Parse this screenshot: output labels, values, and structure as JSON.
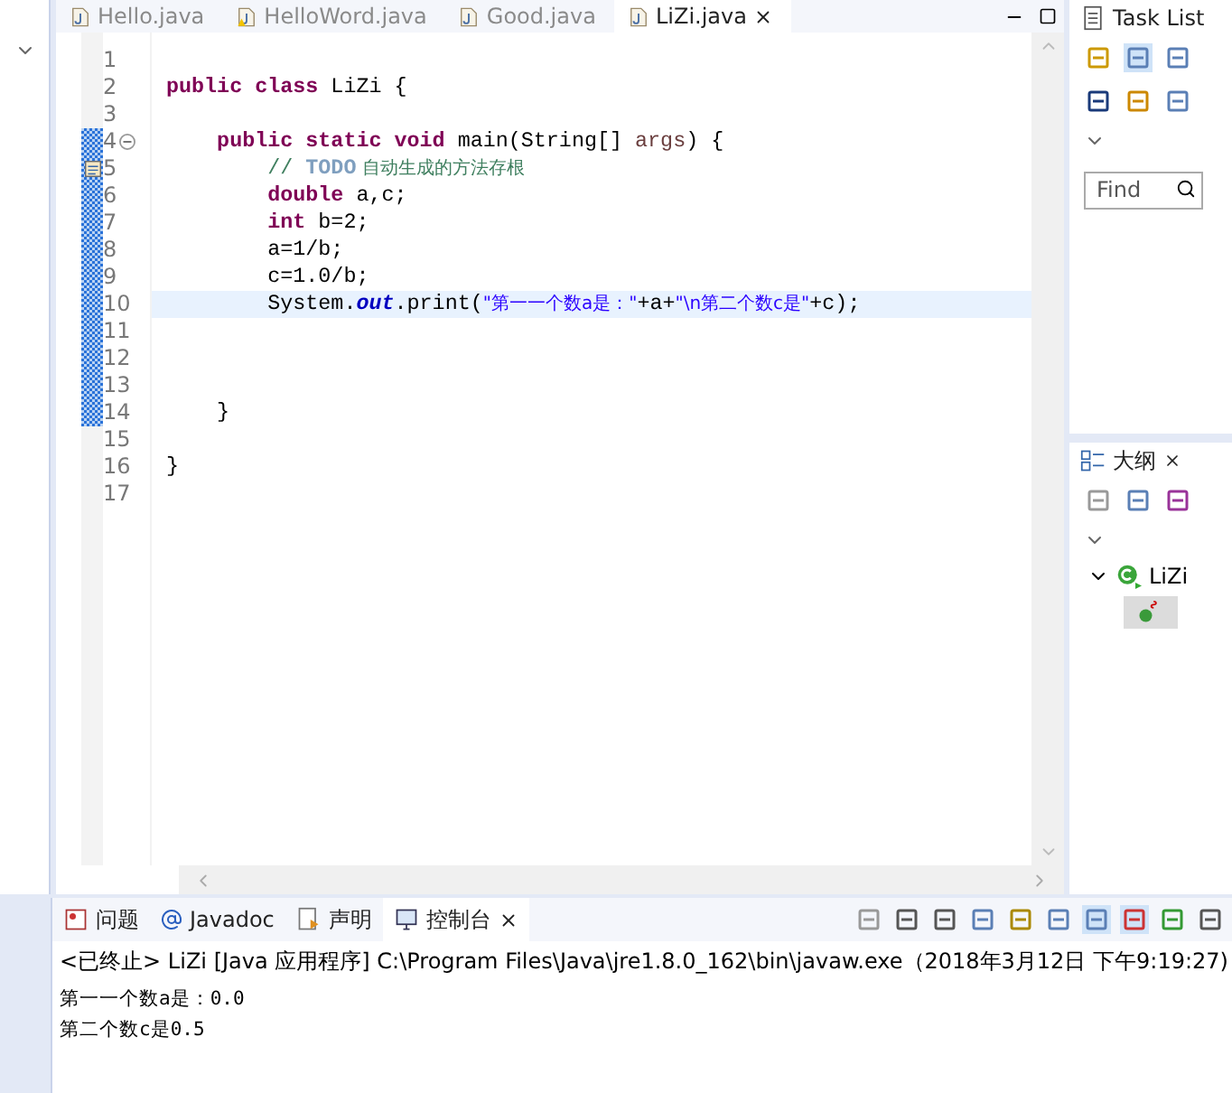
{
  "editor": {
    "tabs": [
      {
        "label": "Hello.java",
        "selected": false,
        "warning": false
      },
      {
        "label": "HelloWord.java",
        "selected": false,
        "warning": true
      },
      {
        "label": "Good.java",
        "selected": false,
        "warning": false
      },
      {
        "label": "LiZi.java",
        "selected": true,
        "warning": false
      }
    ],
    "lines": [
      {
        "number": "1",
        "current": false,
        "changed": false,
        "folding": false,
        "task": false
      },
      {
        "number": "2",
        "current": false,
        "changed": false,
        "folding": false,
        "task": false,
        "tokens": [
          {
            "kind": "keyword",
            "text": "public class"
          },
          {
            "kind": "plain",
            "text": " LiZi {"
          }
        ]
      },
      {
        "number": "3",
        "current": false,
        "changed": false,
        "folding": false,
        "task": false
      },
      {
        "number": "4",
        "current": false,
        "changed": true,
        "folding": true,
        "task": false,
        "tokens": [
          {
            "kind": "keyword",
            "text": "    public static void"
          },
          {
            "kind": "plain",
            "text": " main(String[] "
          },
          {
            "kind": "param",
            "text": "args"
          },
          {
            "kind": "plain",
            "text": ") {"
          }
        ]
      },
      {
        "number": "5",
        "current": false,
        "changed": true,
        "folding": false,
        "task": true,
        "tokens": [
          {
            "kind": "comment",
            "text": "        // "
          },
          {
            "kind": "todo",
            "text": "TODO"
          },
          {
            "kind": "comment",
            "text": " 自动生成的方法存根"
          }
        ]
      },
      {
        "number": "6",
        "current": false,
        "changed": true,
        "folding": false,
        "task": false,
        "tokens": [
          {
            "kind": "keyword",
            "text": "        double"
          },
          {
            "kind": "plain",
            "text": " a,c;"
          }
        ]
      },
      {
        "number": "7",
        "current": false,
        "changed": true,
        "folding": false,
        "task": false,
        "tokens": [
          {
            "kind": "keyword",
            "text": "        int"
          },
          {
            "kind": "plain",
            "text": " b=2;"
          }
        ]
      },
      {
        "number": "8",
        "current": false,
        "changed": true,
        "folding": false,
        "task": false,
        "tokens": [
          {
            "kind": "plain",
            "text": "        a=1/b;"
          }
        ]
      },
      {
        "number": "9",
        "current": false,
        "changed": true,
        "folding": false,
        "task": false,
        "tokens": [
          {
            "kind": "plain",
            "text": "        c=1.0/b;"
          }
        ]
      },
      {
        "number": "10",
        "current": true,
        "changed": true,
        "folding": false,
        "task": false,
        "tokens": [
          {
            "kind": "plain",
            "text": "        System."
          },
          {
            "kind": "field",
            "text": "out"
          },
          {
            "kind": "plain",
            "text": ".print("
          },
          {
            "kind": "string",
            "text": "\"第一一个数a是：\""
          },
          {
            "kind": "plain",
            "text": "+a+"
          },
          {
            "kind": "string",
            "text": "\"\\n第二个数c是\""
          },
          {
            "kind": "plain",
            "text": "+c);"
          }
        ]
      },
      {
        "number": "11",
        "current": false,
        "changed": true,
        "folding": false,
        "task": false
      },
      {
        "number": "12",
        "current": false,
        "changed": true,
        "folding": false,
        "task": false
      },
      {
        "number": "13",
        "current": false,
        "changed": true,
        "folding": false,
        "task": false
      },
      {
        "number": "14",
        "current": false,
        "changed": true,
        "folding": false,
        "task": false,
        "tokens": [
          {
            "kind": "plain",
            "text": "    }"
          }
        ]
      },
      {
        "number": "15",
        "current": false,
        "changed": false,
        "folding": false,
        "task": false
      },
      {
        "number": "16",
        "current": false,
        "changed": false,
        "folding": false,
        "task": false,
        "tokens": [
          {
            "kind": "plain",
            "text": "}"
          }
        ]
      },
      {
        "number": "17",
        "current": false,
        "changed": false,
        "folding": false,
        "task": false
      }
    ]
  },
  "task_list": {
    "title": "Task List",
    "find": {
      "placeholder": "Find"
    }
  },
  "outline": {
    "title": "大纲",
    "tree": [
      {
        "label": "LiZi",
        "kind": "class",
        "expanded": true,
        "children": [
          {
            "kind": "method",
            "selected": true
          }
        ]
      }
    ]
  },
  "console": {
    "tabs": [
      {
        "label": "问题",
        "kind": "problems",
        "selected": false
      },
      {
        "label": "Javadoc",
        "kind": "javadoc",
        "selected": false
      },
      {
        "label": "声明",
        "kind": "declaration",
        "selected": false
      },
      {
        "label": "控制台",
        "kind": "console",
        "selected": true
      }
    ],
    "header": "<已终止> LiZi [Java 应用程序] C:\\Program Files\\Java\\jre1.8.0_162\\bin\\javaw.exe（2018年3月12日 下午9:19:27)",
    "output": [
      "第一一个数a是：0.0",
      "第二个数c是0.5"
    ]
  }
}
